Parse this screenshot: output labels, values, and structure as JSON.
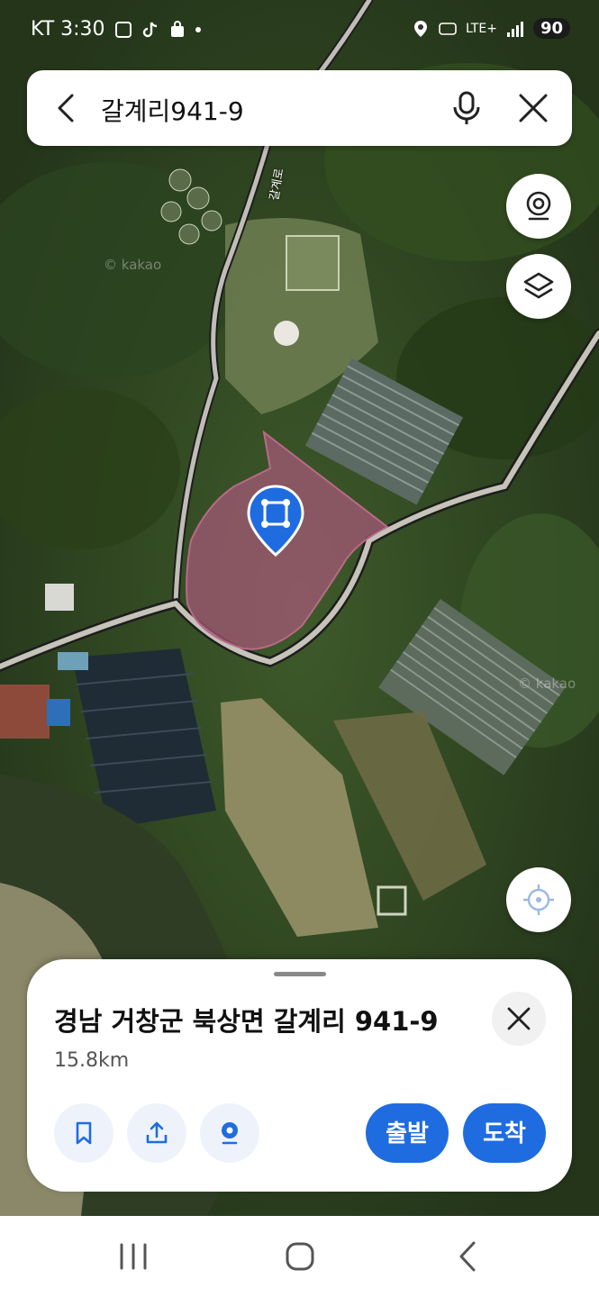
{
  "status_bar": {
    "carrier_time": "KT 3:30",
    "network": "LTE+",
    "battery": "90"
  },
  "search": {
    "query": "갈계리941-9"
  },
  "map": {
    "road_label": "갈계로",
    "watermark": "© kakao"
  },
  "place": {
    "address": "경남 거창군 북상면 갈계리 941-9",
    "distance": "15.8km"
  },
  "actions": {
    "depart": "출발",
    "arrive": "도착"
  },
  "colors": {
    "accent": "#1f6ce0",
    "parcel": "#a8597a"
  },
  "icons": [
    "back-icon",
    "mic-icon",
    "close-icon",
    "roadview-icon",
    "layers-icon",
    "locate-icon",
    "bookmark-icon",
    "share-icon",
    "pin-icon",
    "nav-recents-icon",
    "nav-home-icon",
    "nav-back-icon"
  ]
}
